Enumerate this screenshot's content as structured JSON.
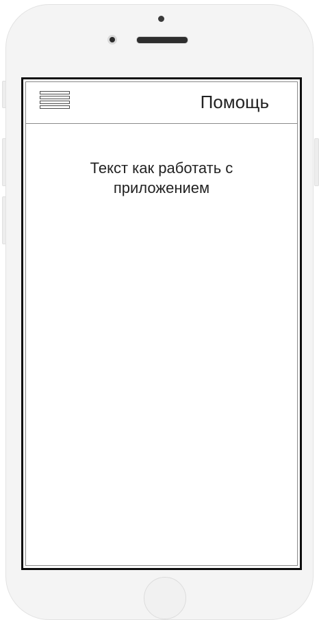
{
  "header": {
    "title": "Помощь",
    "menu_icon": "hamburger-menu-icon"
  },
  "main": {
    "help_text": "Текст как работать с приложением"
  }
}
